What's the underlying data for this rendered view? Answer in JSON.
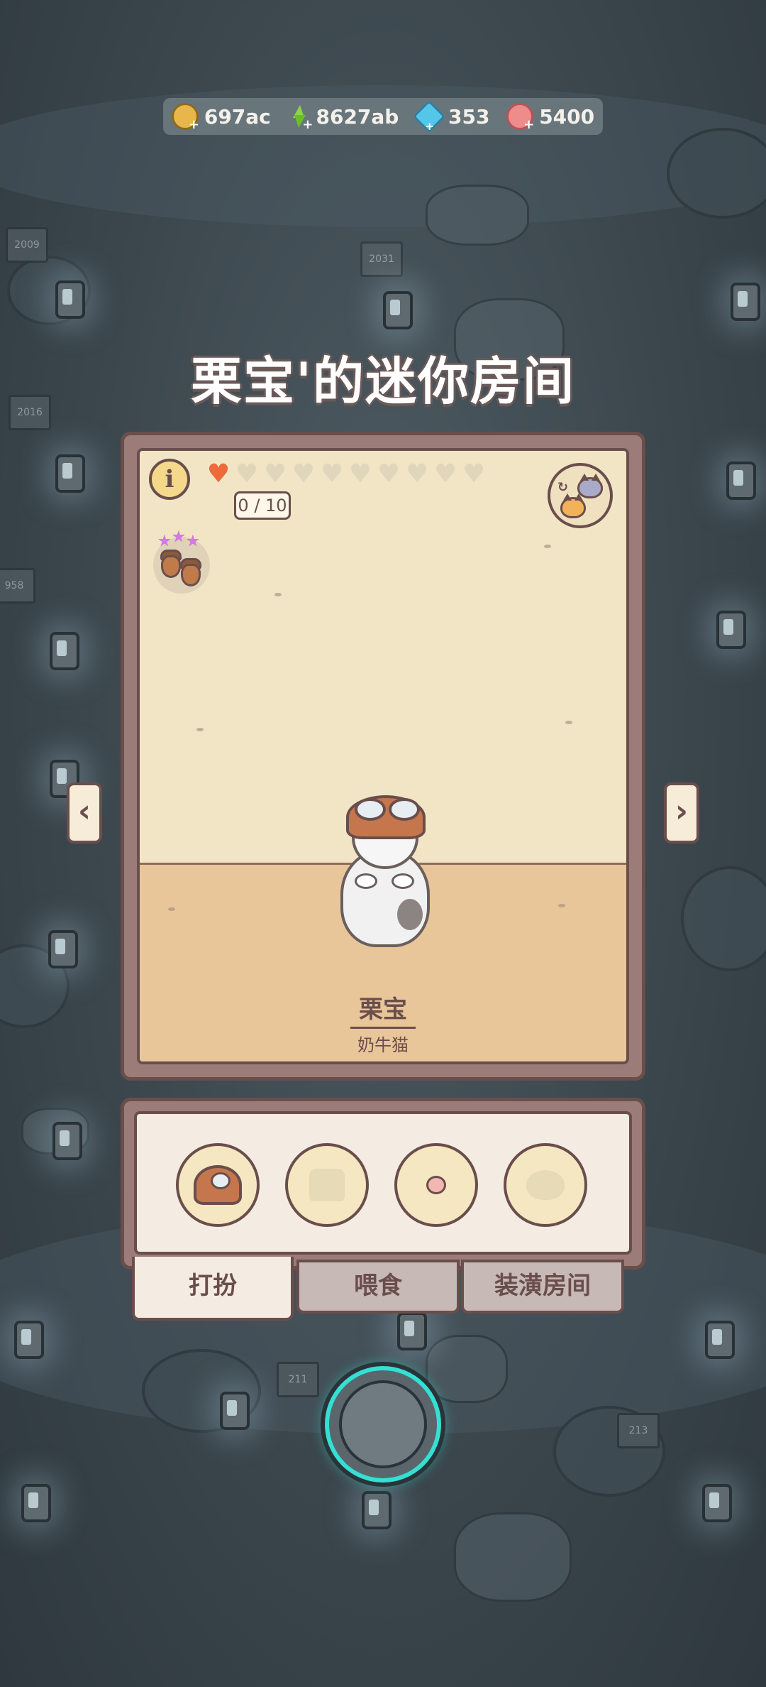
{
  "resources": [
    {
      "name": "coins",
      "icon": "coin-icon",
      "value": "697ac"
    },
    {
      "name": "energy",
      "icon": "lightning-icon",
      "value": "8627ab"
    },
    {
      "name": "gems",
      "icon": "blue-cube-icon",
      "value": "353"
    },
    {
      "name": "shells",
      "icon": "pink-shell-icon",
      "value": "5400"
    }
  ],
  "room": {
    "title": "栗宝'的迷你房间",
    "affection_count": "0 / 10",
    "hearts_total": 10,
    "hearts_filled": 1
  },
  "cat": {
    "name": "栗宝",
    "breed": "奶牛猫"
  },
  "navigation": {
    "prev_arrow": "‹",
    "next_arrow": "›",
    "info_label": "i"
  },
  "item_slots": [
    {
      "name": "hat",
      "icon": "aviator-helmet-icon",
      "state": "equipped"
    },
    {
      "name": "clothes",
      "icon": "shirt-icon",
      "state": "empty"
    },
    {
      "name": "accessory",
      "icon": "pink-bead-icon",
      "state": "equipped"
    },
    {
      "name": "face",
      "icon": "cat-face-icon",
      "state": "empty"
    }
  ],
  "tabs": [
    {
      "label": "打扮",
      "active": true
    },
    {
      "label": "喂食",
      "active": false
    },
    {
      "label": "装潢房间",
      "active": false
    }
  ],
  "colors": {
    "frame_brown": "#6a4e4c",
    "wall": "#f1e5c6",
    "floor": "#e9c59a",
    "home_button_ring": "#34e0d3",
    "heart_filled": "#ef6a3a"
  }
}
